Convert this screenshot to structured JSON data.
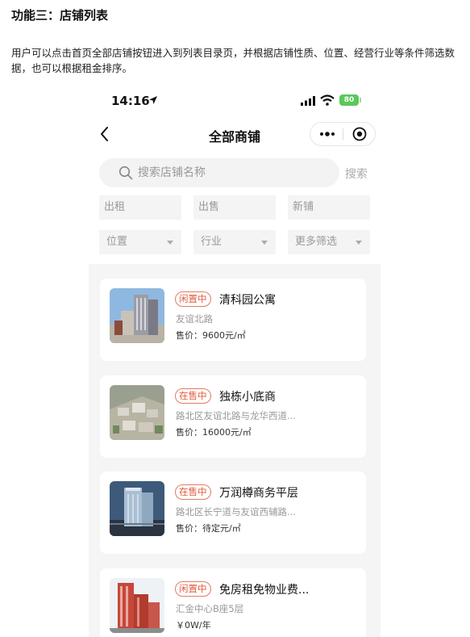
{
  "document": {
    "heading": "功能三：店铺列表",
    "paragraph": "用户可以点击首页全部店铺按钮进入到列表目录页，并根据店铺性质、位置、经营行业等条件筛选数据，也可以根据租金排序。"
  },
  "status_bar": {
    "time": "14:16",
    "battery": "80"
  },
  "nav": {
    "title": "全部商铺"
  },
  "search": {
    "placeholder": "搜索店铺名称",
    "button": "搜索"
  },
  "filters": {
    "types": [
      "出租",
      "出售",
      "新铺"
    ],
    "dropdowns": [
      "位置",
      "行业",
      "更多筛选"
    ]
  },
  "listings": [
    {
      "status": "闲置中",
      "name": "清科园公寓",
      "address": "友谊北路",
      "price": "售价：9600元/㎡"
    },
    {
      "status": "在售中",
      "name": "独栋小底商",
      "address": "路北区友谊北路与龙华西道...",
      "price": "售价：16000元/㎡"
    },
    {
      "status": "在售中",
      "name": "万润樽商务平层",
      "address": "路北区长宁道与友谊西辅路...",
      "price": "售价：待定元/㎡"
    },
    {
      "status": "闲置中",
      "name": "免房租免物业费...",
      "address": "汇金中心B座5层",
      "price": "￥0W/年"
    }
  ],
  "colors": {
    "accent": "#e05a3c",
    "battery": "#5ac85a",
    "list_bg": "#f5f5f5"
  }
}
